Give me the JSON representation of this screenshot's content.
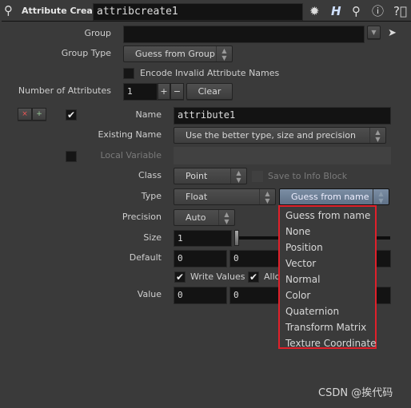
{
  "header": {
    "node_type": "Attribute Create",
    "node_name": "attribcreate1",
    "icons": [
      "node-icon",
      "gear-icon",
      "houdini-h-icon",
      "search-icon",
      "info-icon",
      "help-icon"
    ]
  },
  "params": {
    "group": {
      "label": "Group",
      "value": ""
    },
    "group_type": {
      "label": "Group Type",
      "value": "Guess from Group"
    },
    "encode": {
      "label": "Encode Invalid Attribute Names",
      "checked": false
    },
    "num_attrs": {
      "label": "Number of Attributes",
      "value": "1",
      "plus": "+",
      "minus": "−",
      "clear": "Clear"
    },
    "attr": {
      "remove": "×",
      "insert": "+",
      "enabled": true,
      "name": {
        "label": "Name",
        "value": "attribute1"
      },
      "existing": {
        "label": "Existing Name",
        "value": "Use the better type, size and precision"
      },
      "local_var": {
        "label": "Local Variable",
        "checked": false,
        "value": ""
      },
      "class": {
        "label": "Class",
        "value": "Point"
      },
      "save_info": {
        "label": "Save to Info Block",
        "checked": false
      },
      "type": {
        "label": "Type",
        "value": "Float",
        "qualifier": "Guess from name"
      },
      "precision": {
        "label": "Precision",
        "value": "Auto"
      },
      "size": {
        "label": "Size",
        "value": "1"
      },
      "default": {
        "label": "Default",
        "values": [
          "0",
          "0"
        ]
      },
      "write_values": {
        "label": "Write Values",
        "checked": true
      },
      "allow": {
        "label": "Allo",
        "checked": true
      },
      "value": {
        "label": "Value",
        "values": [
          "0",
          "0"
        ]
      }
    }
  },
  "dropdown": {
    "highlight_color": "#e0202a",
    "options": [
      "Guess from name",
      "None",
      "Position",
      "Vector",
      "Normal",
      "Color",
      "Quaternion",
      "Transform Matrix",
      "Texture Coordinate"
    ]
  },
  "watermark": "CSDN @挨代码"
}
